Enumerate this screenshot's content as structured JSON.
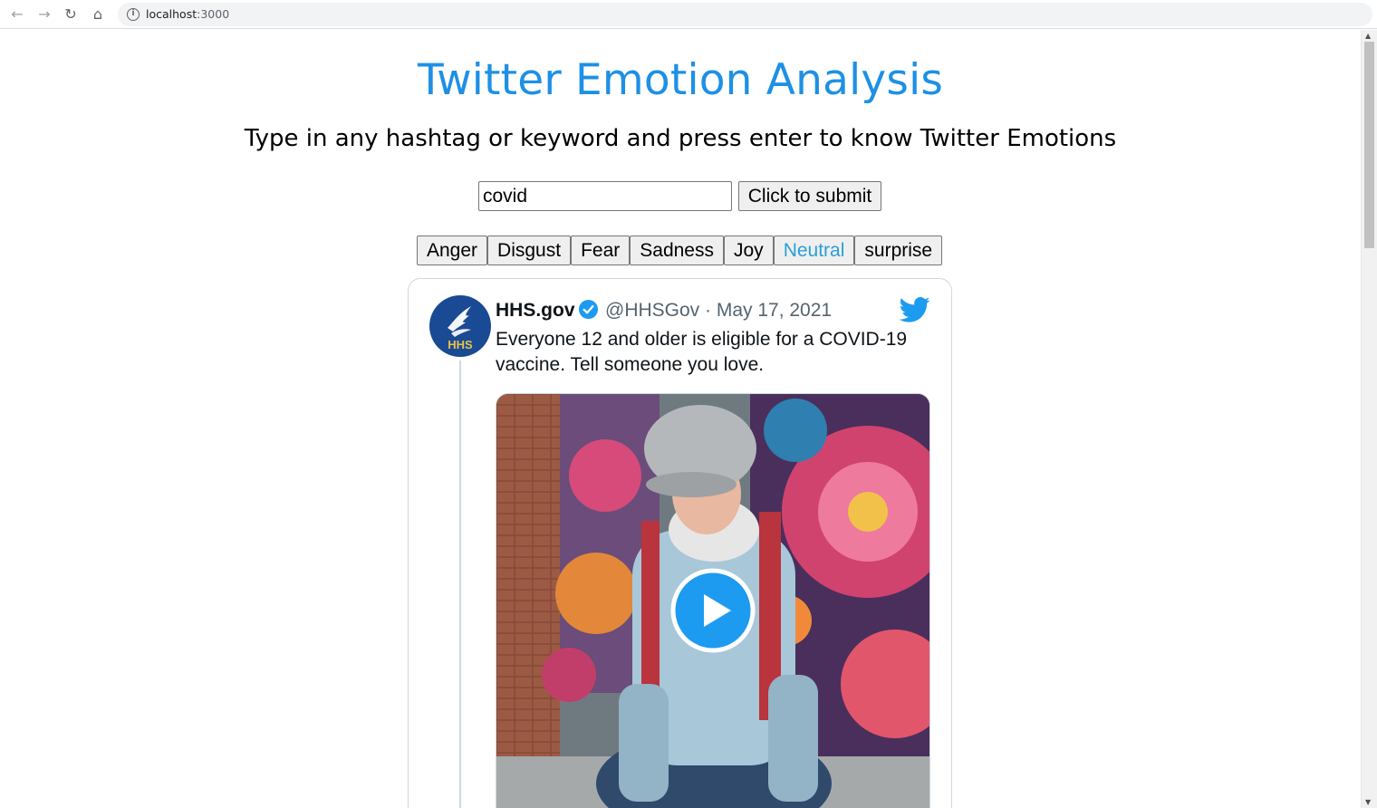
{
  "browser": {
    "url_host": "localhost",
    "url_port": ":3000"
  },
  "page": {
    "title": "Twitter Emotion Analysis",
    "subtitle": "Type in any hashtag or keyword and press enter to know Twitter Emotions"
  },
  "search": {
    "value": "covid",
    "submit_label": "Click to submit"
  },
  "emotions": [
    {
      "label": "Anger",
      "selected": false
    },
    {
      "label": "Disgust",
      "selected": false
    },
    {
      "label": "Fear",
      "selected": false
    },
    {
      "label": "Sadness",
      "selected": false
    },
    {
      "label": "Joy",
      "selected": false
    },
    {
      "label": "Neutral",
      "selected": true
    },
    {
      "label": "surprise",
      "selected": false
    }
  ],
  "tweet": {
    "avatar_text": "HHS",
    "name": "HHS.gov",
    "handle_date": "@HHSGov · May 17, 2021",
    "text": "Everyone 12 and older is eligible for a COVID-19 vaccine. Tell someone you love."
  },
  "colors": {
    "accent": "#1e90e5",
    "selected_emotion": "#29a0d6",
    "twitter_blue": "#1d9bf0"
  }
}
